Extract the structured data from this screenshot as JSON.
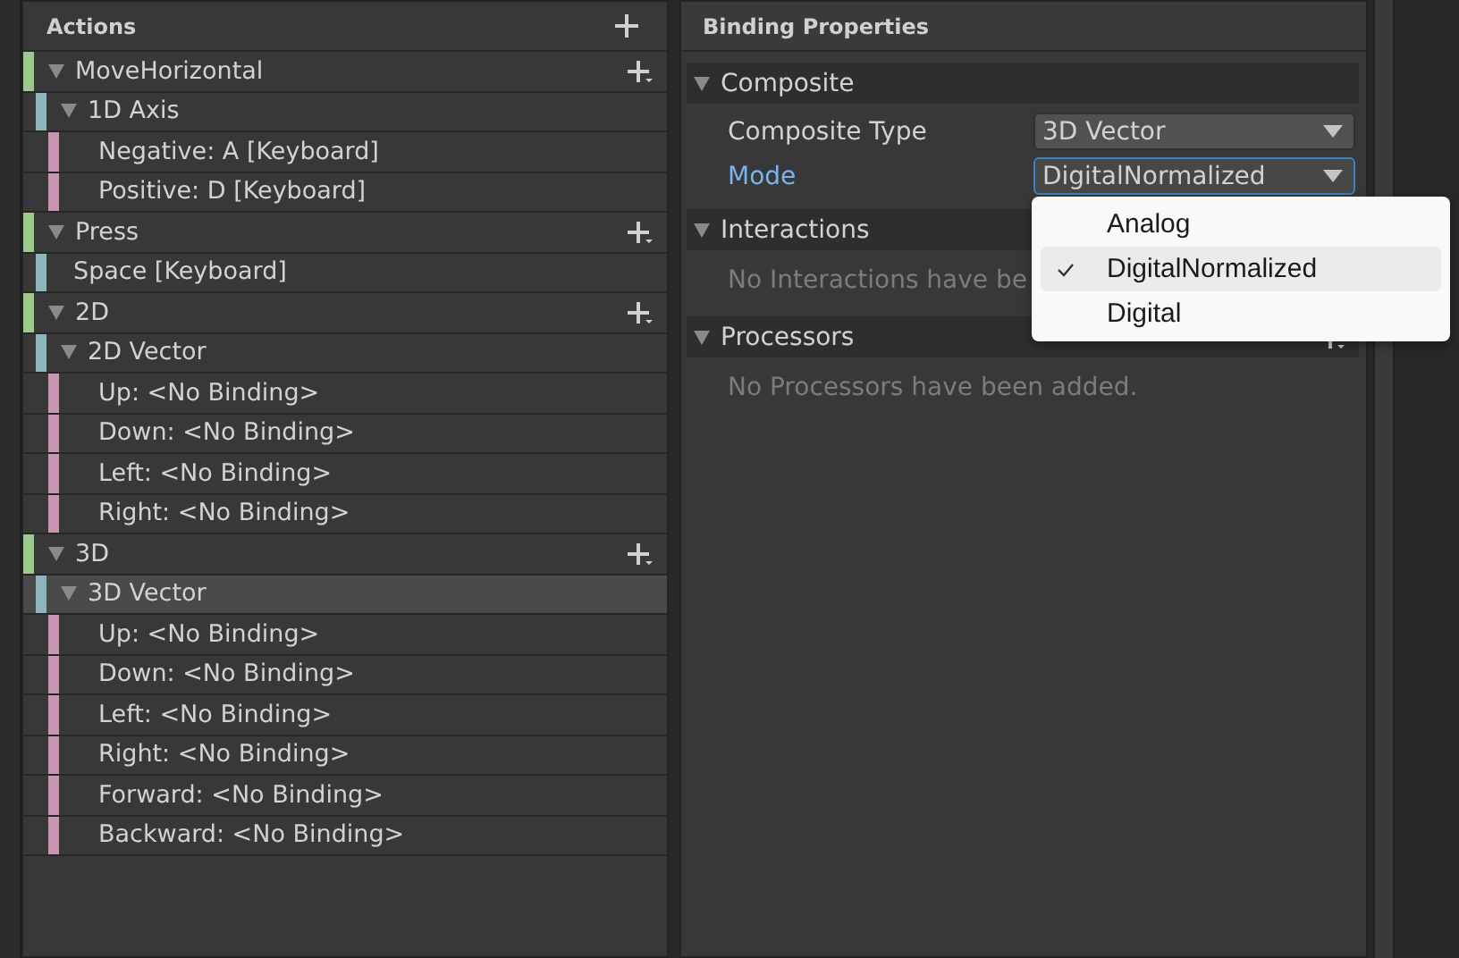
{
  "actions_panel": {
    "title": "Actions",
    "items": [
      {
        "label": "MoveHorizontal",
        "expanded": true,
        "selected": false,
        "children": [
          {
            "label": "1D Axis",
            "expanded": true,
            "selected": false,
            "children": [
              {
                "label": "Negative: A [Keyboard]",
                "selected": false
              },
              {
                "label": "Positive: D [Keyboard]",
                "selected": false
              }
            ]
          }
        ]
      },
      {
        "label": "Press",
        "expanded": true,
        "selected": false,
        "children": [
          {
            "label": "Space [Keyboard]",
            "selected": false
          }
        ]
      },
      {
        "label": "2D",
        "expanded": true,
        "selected": false,
        "children": [
          {
            "label": "2D Vector",
            "expanded": true,
            "selected": false,
            "children": [
              {
                "label": "Up: <No Binding>",
                "selected": false
              },
              {
                "label": "Down: <No Binding>",
                "selected": false
              },
              {
                "label": "Left: <No Binding>",
                "selected": false
              },
              {
                "label": "Right: <No Binding>",
                "selected": false
              }
            ]
          }
        ]
      },
      {
        "label": "3D",
        "expanded": true,
        "selected": false,
        "children": [
          {
            "label": "3D Vector",
            "expanded": true,
            "selected": true,
            "children": [
              {
                "label": "Up: <No Binding>",
                "selected": false
              },
              {
                "label": "Down: <No Binding>",
                "selected": false
              },
              {
                "label": "Left: <No Binding>",
                "selected": false
              },
              {
                "label": "Right: <No Binding>",
                "selected": false
              },
              {
                "label": "Forward: <No Binding>",
                "selected": false
              },
              {
                "label": "Backward: <No Binding>",
                "selected": false
              }
            ]
          }
        ]
      }
    ]
  },
  "properties_panel": {
    "title": "Binding Properties",
    "sections": [
      {
        "title": "Composite",
        "expanded": true,
        "fields": [
          {
            "label": "Composite Type",
            "value": "3D Vector",
            "focused": false
          },
          {
            "label": "Mode",
            "value": "DigitalNormalized",
            "focused": true
          }
        ]
      },
      {
        "title": "Interactions",
        "expanded": true,
        "message": "No Interactions have be"
      },
      {
        "title": "Processors",
        "expanded": true,
        "add_button": true,
        "message": "No Processors have been added."
      }
    ]
  },
  "dropdown": {
    "options": [
      {
        "label": "Analog",
        "selected": false
      },
      {
        "label": "DigitalNormalized",
        "selected": true
      },
      {
        "label": "Digital",
        "selected": false
      }
    ]
  }
}
